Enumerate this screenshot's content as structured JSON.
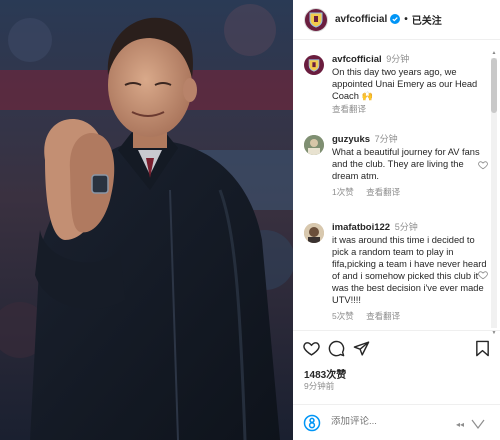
{
  "post": {
    "username": "avfcofficial",
    "follow_status": "已关注",
    "caption_user": "avfcofficial",
    "caption_time": "9分钟",
    "caption_text": "On this day two years ago, we appointed Unai Emery as our Head Coach 🙌",
    "caption_translate": "查看翻译"
  },
  "comments": [
    {
      "user": "guzyuks",
      "time": "7分钟",
      "text": "What a beautiful journey for AV fans and the club. They are living the dream atm.",
      "likes": "1次赞",
      "translate": "查看翻译"
    },
    {
      "user": "imafatboi122",
      "time": "5分钟",
      "text": "it was around this time i decided to pick a random team to play in fifa,picking a team i have never heard of and i somehow picked this club it was the best decision i've ever made UTV!!!!",
      "likes": "5次赞",
      "translate": "查看翻译"
    }
  ],
  "footer": {
    "likes": "1483次赞",
    "time_ago": "9分钟前",
    "add_comment_placeholder": "添加评论..."
  },
  "colors": {
    "verified": "#0095f6",
    "badge_bg": "#6a1d3e",
    "text_primary": "#262626",
    "text_secondary": "#8e8e8e"
  },
  "icons": [
    "verified-icon",
    "heart-icon",
    "comment-icon",
    "share-icon",
    "bookmark-icon",
    "emoji-icon",
    "scroll-arrow-icon"
  ]
}
